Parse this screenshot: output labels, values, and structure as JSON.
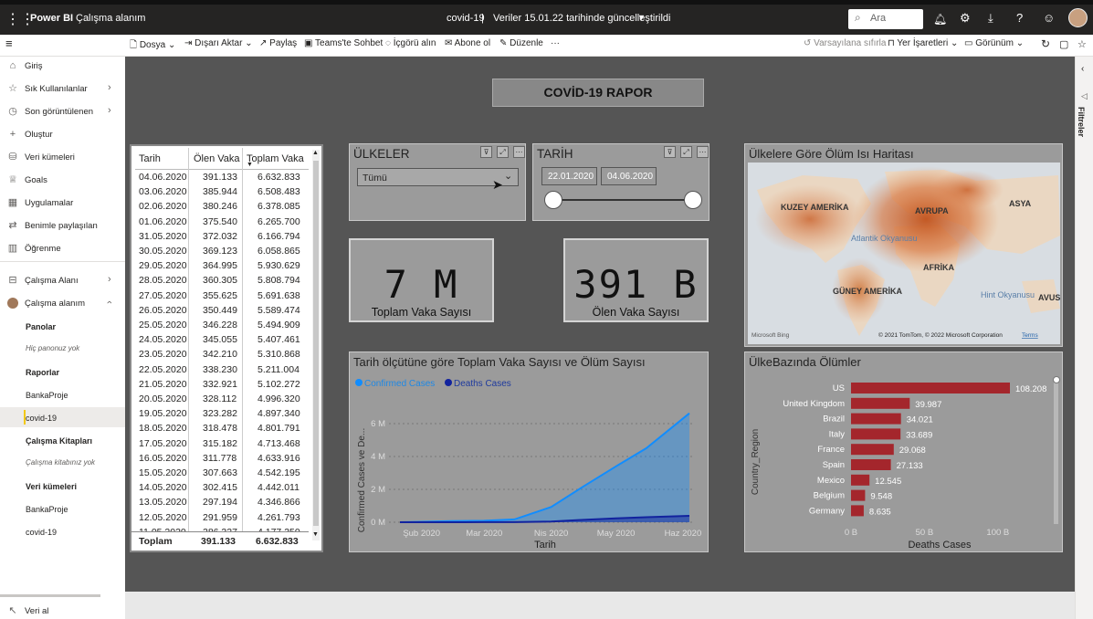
{
  "topbar": {
    "brand": "Power BI",
    "workspace": "Çalışma alanım",
    "report": "covid-19",
    "sep": "|",
    "updated": "Veriler 15.01.22 tarihinde güncelleştirildi",
    "search_placeholder": "Ara"
  },
  "toolbar": {
    "file": "Dosya",
    "export": "Dışarı Aktar",
    "share": "Paylaş",
    "teams": "Teams'te Sohbet",
    "insights": "İçgörü alın",
    "subscribe": "Abone ol",
    "edit": "Düzenle",
    "more": "···",
    "reset": "Varsayılana sıfırla",
    "bookmarks": "Yer İşaretleri",
    "view": "Görünüm"
  },
  "sidebar": {
    "items": [
      {
        "label": "Giriş",
        "icon": "home-icon"
      },
      {
        "label": "Sık Kullanılanlar",
        "icon": "star-icon"
      },
      {
        "label": "Son görüntülenen",
        "icon": "clock-icon"
      },
      {
        "label": "Oluştur",
        "icon": "plus-icon"
      },
      {
        "label": "Veri kümeleri",
        "icon": "database-icon"
      },
      {
        "label": "Goals",
        "icon": "trophy-icon"
      },
      {
        "label": "Uygulamalar",
        "icon": "apps-icon"
      },
      {
        "label": "Benimle paylaşılan",
        "icon": "share-icon"
      },
      {
        "label": "Öğrenme",
        "icon": "book-icon"
      },
      {
        "label": "Çalışma Alanı",
        "icon": "workspace-icon"
      },
      {
        "label": "Çalışma alanım",
        "icon": "user-avatar-icon"
      }
    ],
    "sections": {
      "panolar": "Panolar",
      "panolar_empty": "Hiç panonuz yok",
      "raporlar": "Raporlar",
      "rapor1": "BankaProje",
      "rapor2": "covid-19",
      "kitaplar": "Çalışma Kitapları",
      "kitaplar_empty": "Çalışma kitabınız yok",
      "veri": "Veri kümeleri",
      "veri1": "BankaProje",
      "veri2": "covid-19"
    },
    "footer": "Veri al"
  },
  "report": {
    "title": "COVİD-19 RAPOR",
    "countries_slicer": {
      "title": "ÜLKELER",
      "value": "Tümü"
    },
    "date_slicer": {
      "title": "TARİH",
      "from": "22.01.2020",
      "to": "04.06.2020"
    },
    "card_total": {
      "value": "7 M",
      "label": "Toplam Vaka Sayısı"
    },
    "card_deaths": {
      "value": "391 B",
      "label": "Ölen Vaka Sayısı"
    },
    "map": {
      "title": "Ülkelere Göre Ölüm Isı Haritası",
      "labels": [
        "KUZEY AMERİKA",
        "AVRUPA",
        "ASYA",
        "Atlantik Okyanusu",
        "AFRİKA",
        "GÜNEY AMERİKA",
        "Hint Okyanusu",
        "AVUS"
      ],
      "brand": "Microsoft Bing",
      "copyright": "© 2021 TomTom, © 2022 Microsoft Corporation",
      "terms": "Terms"
    },
    "table": {
      "headers": [
        "Tarih",
        "Ölen Vaka",
        "Toplam Vaka"
      ],
      "rows": [
        [
          "04.06.2020",
          "391.133",
          "6.632.833"
        ],
        [
          "03.06.2020",
          "385.944",
          "6.508.483"
        ],
        [
          "02.06.2020",
          "380.246",
          "6.378.085"
        ],
        [
          "01.06.2020",
          "375.540",
          "6.265.700"
        ],
        [
          "31.05.2020",
          "372.032",
          "6.166.794"
        ],
        [
          "30.05.2020",
          "369.123",
          "6.058.865"
        ],
        [
          "29.05.2020",
          "364.995",
          "5.930.629"
        ],
        [
          "28.05.2020",
          "360.305",
          "5.808.794"
        ],
        [
          "27.05.2020",
          "355.625",
          "5.691.638"
        ],
        [
          "26.05.2020",
          "350.449",
          "5.589.474"
        ],
        [
          "25.05.2020",
          "346.228",
          "5.494.909"
        ],
        [
          "24.05.2020",
          "345.055",
          "5.407.461"
        ],
        [
          "23.05.2020",
          "342.210",
          "5.310.868"
        ],
        [
          "22.05.2020",
          "338.230",
          "5.211.004"
        ],
        [
          "21.05.2020",
          "332.921",
          "5.102.272"
        ],
        [
          "20.05.2020",
          "328.112",
          "4.996.320"
        ],
        [
          "19.05.2020",
          "323.282",
          "4.897.340"
        ],
        [
          "18.05.2020",
          "318.478",
          "4.801.791"
        ],
        [
          "17.05.2020",
          "315.182",
          "4.713.468"
        ],
        [
          "16.05.2020",
          "311.778",
          "4.633.916"
        ],
        [
          "15.05.2020",
          "307.663",
          "4.542.195"
        ],
        [
          "14.05.2020",
          "302.415",
          "4.442.011"
        ],
        [
          "13.05.2020",
          "297.194",
          "4.346.866"
        ],
        [
          "12.05.2020",
          "291.959",
          "4.261.793"
        ],
        [
          "11.05.2020",
          "286.327",
          "4.177.350"
        ]
      ],
      "total": [
        "Toplam",
        "391.133",
        "6.632.833"
      ]
    },
    "colors": {
      "confirmed": "#118dff",
      "deaths": "#12239e",
      "bar": "#a4262c",
      "canvas": "#555555"
    }
  },
  "chart_data": [
    {
      "type": "area",
      "title": "Tarih ölçütüne göre Toplam Vaka Sayısı ve Ölüm Sayısı",
      "xlabel": "Tarih",
      "ylabel": "Confirmed Cases ve De...",
      "ylim": [
        0,
        7000000
      ],
      "yticks": [
        "0 M",
        "2 M",
        "4 M",
        "6 M"
      ],
      "xticks": [
        "Şub 2020",
        "Mar 2020",
        "Nis 2020",
        "May 2020",
        "Haz 2020"
      ],
      "legend": "top-left",
      "x": [
        "2020-01-22",
        "2020-02-15",
        "2020-03-01",
        "2020-03-15",
        "2020-04-01",
        "2020-04-15",
        "2020-05-01",
        "2020-05-15",
        "2020-06-04"
      ],
      "series": [
        {
          "name": "Confirmed Cases",
          "values": [
            600,
            69000,
            88000,
            170000,
            930000,
            2100000,
            3400000,
            4500000,
            6630000
          ]
        },
        {
          "name": "Deaths Cases",
          "values": [
            17,
            1700,
            3000,
            6500,
            47000,
            140000,
            240000,
            308000,
            391000
          ]
        }
      ]
    },
    {
      "type": "bar",
      "title": "ÜlkeBazında Ölümler",
      "xlabel": "Deaths Cases",
      "ylabel": "Country_Region",
      "xticks": [
        "0 B",
        "50 B",
        "100 B"
      ],
      "xlim": [
        0,
        120000
      ],
      "categories": [
        "US",
        "United Kingdom",
        "Brazil",
        "Italy",
        "France",
        "Spain",
        "Mexico",
        "Belgium",
        "Germany"
      ],
      "values": [
        108208,
        39987,
        34021,
        33689,
        29068,
        27133,
        12545,
        9548,
        8635
      ],
      "labels": [
        "108.208",
        "39.987",
        "34.021",
        "33.689",
        "29.068",
        "27.133",
        "12.545",
        "9.548",
        "8.635"
      ]
    }
  ]
}
